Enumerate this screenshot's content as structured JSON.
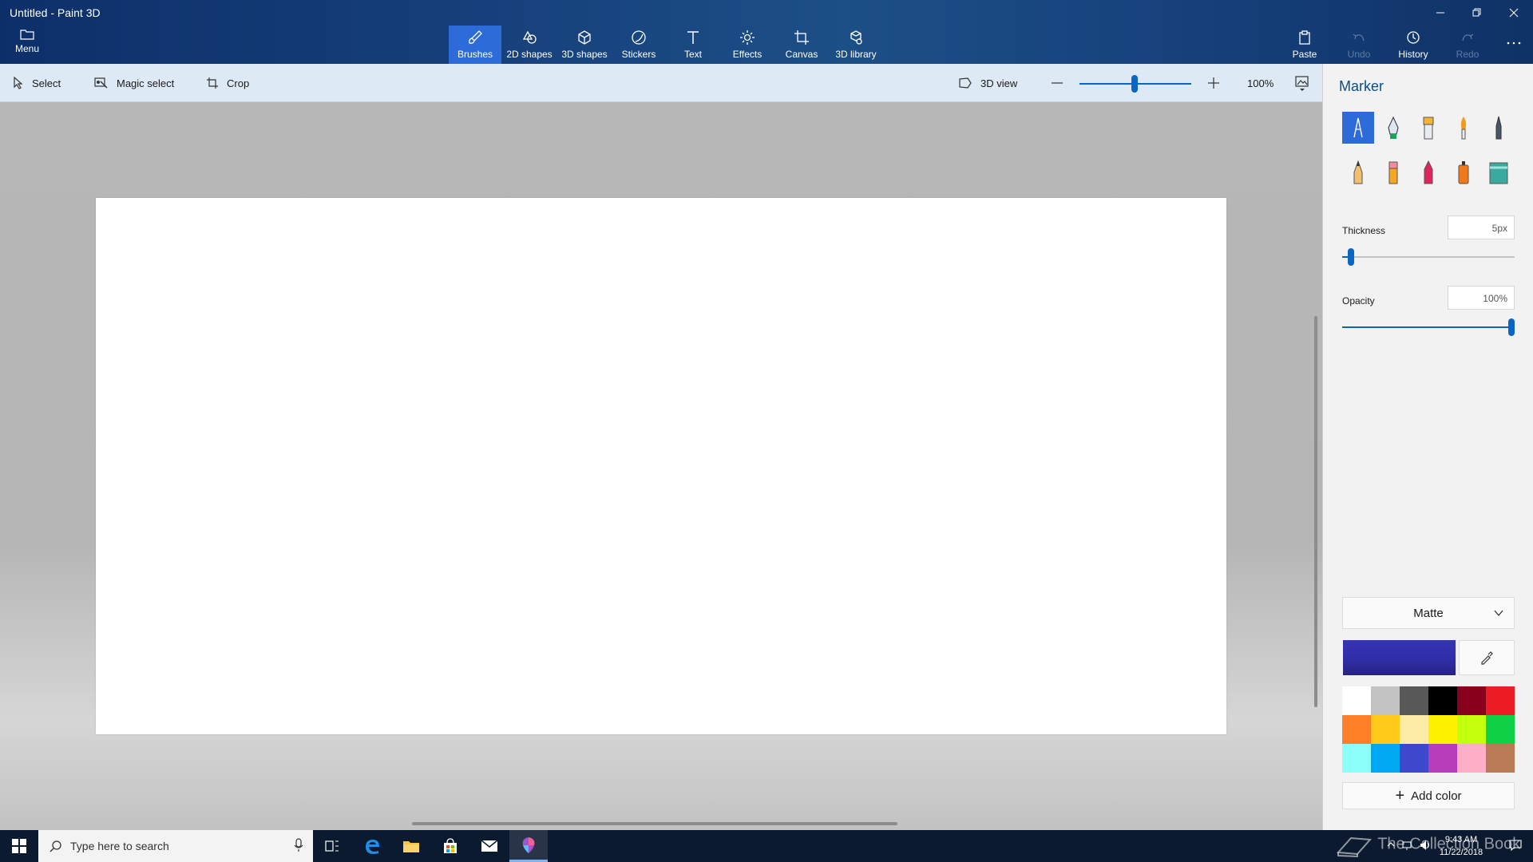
{
  "window": {
    "title": "Untitled - Paint 3D"
  },
  "ribbon": {
    "menu_label": "Menu",
    "tabs": [
      {
        "label": "Brushes",
        "icon": "brush-icon",
        "active": true
      },
      {
        "label": "2D shapes",
        "icon": "2d-shapes-icon"
      },
      {
        "label": "3D shapes",
        "icon": "3d-shapes-icon"
      },
      {
        "label": "Stickers",
        "icon": "stickers-icon"
      },
      {
        "label": "Text",
        "icon": "text-icon"
      },
      {
        "label": "Effects",
        "icon": "effects-icon"
      },
      {
        "label": "Canvas",
        "icon": "canvas-icon"
      },
      {
        "label": "3D library",
        "icon": "3d-library-icon"
      }
    ],
    "actions": [
      {
        "label": "Paste",
        "icon": "paste-icon",
        "enabled": true
      },
      {
        "label": "Undo",
        "icon": "undo-icon",
        "enabled": false
      },
      {
        "label": "History",
        "icon": "history-icon",
        "enabled": true
      },
      {
        "label": "Redo",
        "icon": "redo-icon",
        "enabled": false
      }
    ]
  },
  "toolbar": {
    "select_label": "Select",
    "magic_select_label": "Magic select",
    "crop_label": "Crop",
    "view3d_label": "3D view",
    "zoom_value": "100%"
  },
  "panel": {
    "title": "Marker",
    "brushes": [
      "marker-icon",
      "calligraphy-pen-icon",
      "oil-brush-icon",
      "watercolor-icon",
      "pixel-pen-icon",
      "pencil-icon",
      "eraser-icon",
      "crayon-icon",
      "spray-can-icon",
      "fill-icon"
    ],
    "thickness_label": "Thickness",
    "thickness_value": "5px",
    "thickness_level": 0.05,
    "opacity_label": "Opacity",
    "opacity_value": "100%",
    "opacity_level": 1.0,
    "finish_value": "Matte",
    "current_color": "#3633b8",
    "palette": [
      "#ffffff",
      "#c3c3c3",
      "#585858",
      "#000000",
      "#88001b",
      "#ec1c24",
      "#ff7f27",
      "#ffca18",
      "#fdeca6",
      "#fff200",
      "#c4ff0e",
      "#0ed145",
      "#8cfffb",
      "#00a8f3",
      "#3f48cc",
      "#b83dba",
      "#ffaec8",
      "#b97a56"
    ],
    "add_color_label": "Add color"
  },
  "taskbar": {
    "search_placeholder": "Type here to search",
    "time": "9:43 AM",
    "date": "11/22/2018",
    "watermark": "The Collection Book"
  }
}
